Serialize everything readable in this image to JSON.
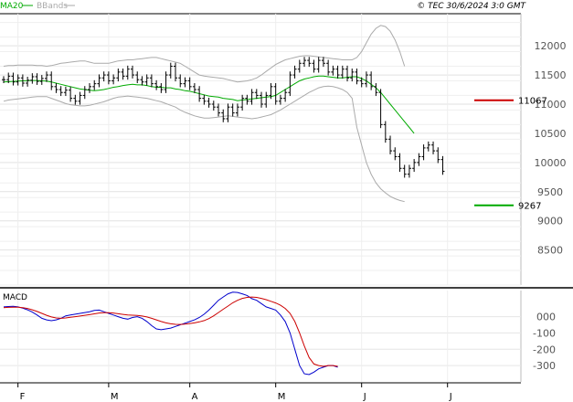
{
  "header": {
    "legend_ma": "MA20",
    "legend_bb": "BBands",
    "copyright": "© TEC 30/6/2024 3:0 GMT",
    "colors": {
      "ma": "#00aa00",
      "bb": "#aaaaaa"
    }
  },
  "chart_data": [
    {
      "type": "candlestick",
      "title": "",
      "y_ticks": [
        8500,
        9000,
        9500,
        10000,
        10500,
        11000,
        11500,
        12000
      ],
      "y_tick_labels": [
        "8500",
        "9000",
        "9500",
        "10000",
        "10500",
        "11000",
        "11500",
        "12000"
      ],
      "ylim": [
        7900,
        12550
      ],
      "x_ticks": [
        "F",
        "M",
        "A",
        "M",
        "J",
        "J"
      ],
      "x_tick_indices": [
        3,
        22,
        39,
        57,
        75,
        93
      ],
      "n_periods": 100,
      "close": [
        11420,
        11480,
        11380,
        11450,
        11360,
        11410,
        11470,
        11390,
        11440,
        11500,
        11300,
        11250,
        11200,
        11240,
        11100,
        11050,
        11150,
        11250,
        11300,
        11350,
        11450,
        11500,
        11400,
        11450,
        11550,
        11480,
        11600,
        11500,
        11420,
        11380,
        11450,
        11350,
        11300,
        11250,
        11500,
        11650,
        11450,
        11350,
        11400,
        11300,
        11250,
        11100,
        11050,
        11000,
        10950,
        10850,
        10750,
        10950,
        10850,
        10950,
        11100,
        11050,
        11200,
        11150,
        11000,
        11150,
        11300,
        11050,
        11100,
        11200,
        11500,
        11600,
        11700,
        11750,
        11700,
        11600,
        11750,
        11700,
        11550,
        11600,
        11500,
        11600,
        11450,
        11550,
        11400,
        11350,
        11500,
        11300,
        11200,
        10650,
        10400,
        10200,
        10100,
        9900,
        9800,
        9900,
        10000,
        10100,
        10250,
        10300,
        10200,
        10050,
        9850,
        null,
        null,
        null,
        null,
        null,
        null,
        null
      ],
      "ma20": [
        11380,
        11385,
        11390,
        11395,
        11400,
        11402,
        11405,
        11405,
        11400,
        11395,
        11380,
        11360,
        11340,
        11320,
        11300,
        11280,
        11260,
        11250,
        11240,
        11230,
        11240,
        11250,
        11270,
        11290,
        11300,
        11320,
        11330,
        11340,
        11330,
        11330,
        11320,
        11300,
        11290,
        11290,
        11280,
        11280,
        11260,
        11250,
        11230,
        11220,
        11200,
        11180,
        11160,
        11140,
        11130,
        11120,
        11100,
        11090,
        11080,
        11060,
        11070,
        11080,
        11090,
        11100,
        11110,
        11120,
        11130,
        11150,
        11200,
        11250,
        11300,
        11350,
        11400,
        11430,
        11450,
        11470,
        11480,
        11480,
        11470,
        11460,
        11450,
        11450,
        11460,
        11470,
        11470,
        11440,
        11400,
        11340,
        11280,
        11200,
        11100,
        11000,
        10900,
        10800,
        10700,
        10600,
        10500,
        null,
        null,
        null,
        null,
        null,
        null,
        null,
        null,
        null,
        null,
        null,
        null,
        null
      ],
      "bb_upper": [
        11650,
        11660,
        11660,
        11670,
        11670,
        11670,
        11670,
        11660,
        11660,
        11650,
        11660,
        11680,
        11700,
        11710,
        11720,
        11730,
        11740,
        11740,
        11720,
        11700,
        11700,
        11700,
        11700,
        11720,
        11740,
        11750,
        11760,
        11760,
        11770,
        11780,
        11790,
        11800,
        11800,
        11780,
        11760,
        11740,
        11720,
        11700,
        11650,
        11600,
        11550,
        11500,
        11480,
        11470,
        11460,
        11450,
        11440,
        11420,
        11400,
        11380,
        11390,
        11400,
        11420,
        11450,
        11500,
        11560,
        11620,
        11680,
        11720,
        11760,
        11780,
        11800,
        11820,
        11830,
        11830,
        11820,
        11810,
        11800,
        11790,
        11780,
        11770,
        11760,
        11760,
        11760,
        11800,
        11900,
        12050,
        12200,
        12300,
        12350,
        12330,
        12250,
        12100,
        11900,
        11650,
        null,
        null,
        null,
        null,
        null,
        null,
        null,
        null,
        null,
        null,
        null,
        null,
        null,
        null,
        null
      ],
      "bb_lower": [
        11050,
        11070,
        11080,
        11090,
        11100,
        11110,
        11120,
        11130,
        11130,
        11130,
        11100,
        11070,
        11040,
        11010,
        10990,
        10980,
        10970,
        10970,
        10980,
        11000,
        11020,
        11040,
        11070,
        11100,
        11120,
        11130,
        11140,
        11130,
        11120,
        11110,
        11100,
        11080,
        11060,
        11040,
        11010,
        10980,
        10950,
        10900,
        10860,
        10830,
        10800,
        10780,
        10760,
        10760,
        10770,
        10780,
        10790,
        10800,
        10790,
        10780,
        10770,
        10760,
        10750,
        10760,
        10780,
        10800,
        10820,
        10860,
        10900,
        10950,
        11000,
        11050,
        11100,
        11150,
        11200,
        11240,
        11280,
        11300,
        11310,
        11300,
        11280,
        11250,
        11200,
        11100,
        10600,
        10300,
        10000,
        9800,
        9650,
        9550,
        9480,
        9420,
        9380,
        9350,
        9330,
        null,
        null,
        null,
        null,
        null,
        null,
        null,
        null,
        null,
        null,
        null,
        null,
        null,
        null,
        null
      ],
      "levels": [
        {
          "value": 11067,
          "label": "11067",
          "color": "#cc0000"
        },
        {
          "value": 9267,
          "label": "9267",
          "color": "#00aa00"
        }
      ]
    },
    {
      "type": "line",
      "title": "MACD",
      "y_ticks": [
        0,
        -100,
        -200,
        -300
      ],
      "y_tick_labels": [
        "000",
        "-100",
        "-200",
        "-300"
      ],
      "ylim": [
        -400,
        160
      ],
      "series": [
        {
          "name": "",
          "color": "#0000cc",
          "values": [
            60,
            62,
            63,
            60,
            52,
            42,
            28,
            10,
            -10,
            -20,
            -25,
            -20,
            -10,
            5,
            10,
            15,
            20,
            25,
            30,
            38,
            40,
            30,
            20,
            10,
            0,
            -10,
            -15,
            -5,
            0,
            -10,
            -30,
            -55,
            -75,
            -80,
            -75,
            -70,
            -60,
            -50,
            -40,
            -30,
            -20,
            -5,
            15,
            40,
            70,
            100,
            120,
            140,
            150,
            148,
            140,
            130,
            110,
            100,
            80,
            60,
            50,
            40,
            10,
            -30,
            -100,
            -200,
            -300,
            -350,
            -355,
            -340,
            -320,
            -310,
            -300,
            -300,
            -310,
            null,
            null,
            null,
            null,
            null,
            null,
            null,
            null,
            null,
            null,
            null,
            null,
            null,
            null,
            null,
            null,
            null,
            null,
            null,
            null,
            null,
            null,
            null,
            null,
            null,
            null,
            null,
            null,
            null
          ]
        },
        {
          "name": "",
          "color": "#cc0000",
          "values": [
            55,
            57,
            58,
            58,
            55,
            50,
            42,
            32,
            20,
            8,
            -2,
            -8,
            -10,
            -8,
            -4,
            0,
            4,
            8,
            12,
            17,
            22,
            24,
            24,
            22,
            18,
            14,
            10,
            9,
            7,
            4,
            -2,
            -10,
            -20,
            -30,
            -38,
            -44,
            -47,
            -48,
            -46,
            -42,
            -38,
            -32,
            -24,
            -12,
            5,
            25,
            45,
            65,
            85,
            100,
            112,
            118,
            120,
            118,
            112,
            104,
            94,
            84,
            70,
            50,
            20,
            -30,
            -100,
            -180,
            -250,
            -290,
            -300,
            -305,
            -300,
            -300,
            -305,
            null,
            null,
            null,
            null,
            null,
            null,
            null,
            null,
            null,
            null,
            null,
            null,
            null,
            null,
            null,
            null,
            null,
            null,
            null,
            null,
            null,
            null,
            null,
            null,
            null,
            null,
            null,
            null,
            null
          ]
        }
      ]
    }
  ]
}
